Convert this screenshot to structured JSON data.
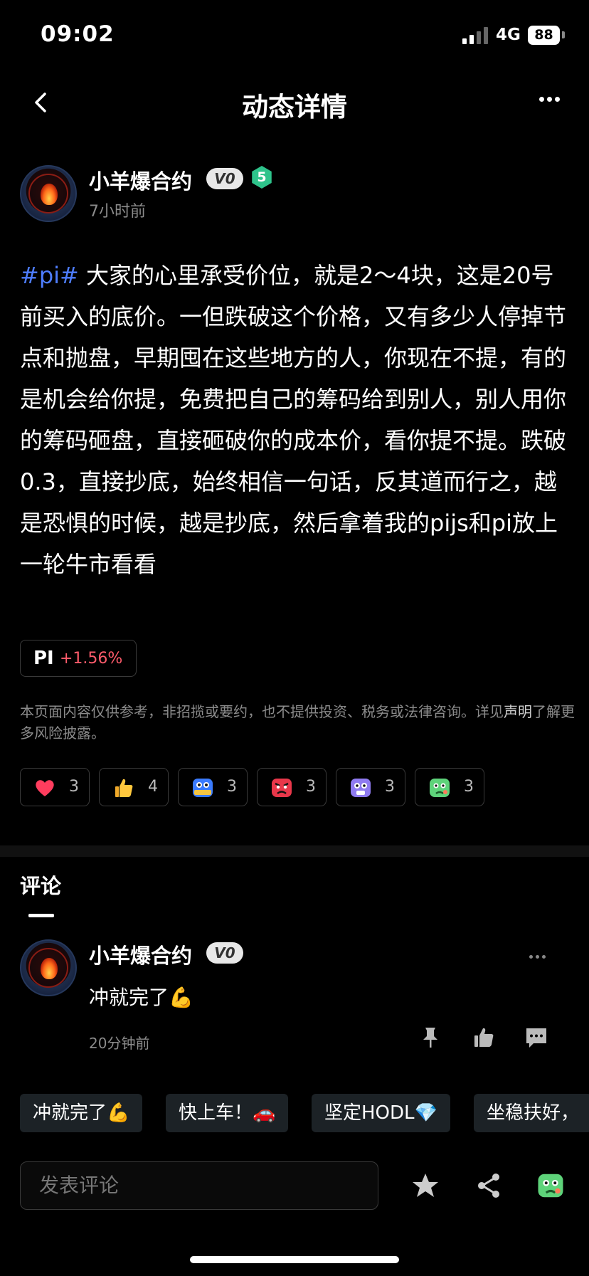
{
  "status_bar": {
    "time": "09:02",
    "network": "4G",
    "battery": "88"
  },
  "nav": {
    "title": "动态详情"
  },
  "post": {
    "author": "小羊爆合约",
    "vip": "V0",
    "level": "5",
    "time": "7小时前",
    "hashtag": "#pi#",
    "body": " 大家的心里承受价位，就是2～4块，这是20号前买入的底价。一但跌破这个价格，又有多少人停掉节点和抛盘，早期囤在这些地方的人，你现在不提，有的是机会给你提，免费把自己的筹码给到别人，别人用你的筹码砸盘，直接砸破你的成本价，看你提不提。跌破0.3，直接抄底，始终相信一句话，反其道而行之，越是恐惧的时候，越是抄底，然后拿着我的pijs和pi放上一轮牛市看看",
    "ticker_symbol": "PI",
    "ticker_change": "+1.56%",
    "disclaimer_text": "本页面内容仅供参考，非招揽或要约，也不提供投资、税务或法律咨询。详见",
    "disclaimer_link": "声明",
    "disclaimer_tail": "了解更多风险披露。"
  },
  "reactions": [
    {
      "icon": "heart-icon",
      "count": "3"
    },
    {
      "icon": "thumbs-up-icon",
      "count": "4"
    },
    {
      "icon": "hodl-face-icon",
      "count": "3"
    },
    {
      "icon": "angry-face-icon",
      "count": "3"
    },
    {
      "icon": "shocked-face-icon",
      "count": "3"
    },
    {
      "icon": "sick-face-icon",
      "count": "3"
    }
  ],
  "comments_section": {
    "title": "评论"
  },
  "comment": {
    "author": "小羊爆合约",
    "vip": "V0",
    "text": "冲就完了💪",
    "time": "20分钟前"
  },
  "quick_replies": [
    "冲就完了💪",
    "快上车！🚗",
    "坚定HODL💎",
    "坐稳扶好，"
  ],
  "input": {
    "placeholder": "发表评论"
  },
  "colors": {
    "accent_blue": "#4e7dff",
    "gain_red": "#ff5b6b",
    "level_green": "#2ec38b"
  }
}
